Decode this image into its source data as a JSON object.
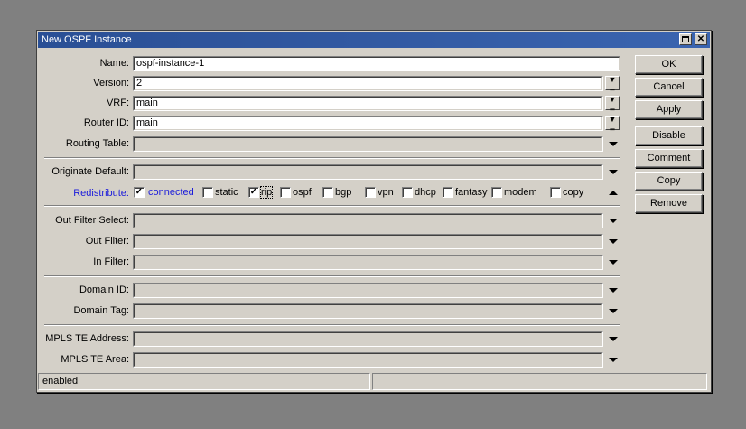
{
  "window": {
    "title": "New OSPF Instance"
  },
  "fields": {
    "name": {
      "label": "Name:",
      "value": "ospf-instance-1"
    },
    "version": {
      "label": "Version:",
      "value": "2"
    },
    "vrf": {
      "label": "VRF:",
      "value": "main"
    },
    "router_id": {
      "label": "Router ID:",
      "value": "main"
    },
    "routing_table": {
      "label": "Routing Table:",
      "value": ""
    },
    "originate_default": {
      "label": "Originate Default:",
      "value": ""
    },
    "out_filter_select": {
      "label": "Out Filter Select:",
      "value": ""
    },
    "out_filter": {
      "label": "Out Filter:",
      "value": ""
    },
    "in_filter": {
      "label": "In Filter:",
      "value": ""
    },
    "domain_id": {
      "label": "Domain ID:",
      "value": ""
    },
    "domain_tag": {
      "label": "Domain Tag:",
      "value": ""
    },
    "mpls_te_address": {
      "label": "MPLS TE Address:",
      "value": ""
    },
    "mpls_te_area": {
      "label": "MPLS TE Area:",
      "value": ""
    }
  },
  "redistribute": {
    "label": "Redistribute:",
    "label_color": "#1a1adb",
    "options": [
      {
        "label": "connected",
        "checked": true
      },
      {
        "label": "static",
        "checked": false
      },
      {
        "label": "rip",
        "checked": true
      },
      {
        "label": "ospf",
        "checked": false
      },
      {
        "label": "bgp",
        "checked": false
      },
      {
        "label": "vpn",
        "checked": false
      },
      {
        "label": "dhcp",
        "checked": false
      },
      {
        "label": "fantasy",
        "checked": false
      },
      {
        "label": "modem",
        "checked": false
      },
      {
        "label": "copy",
        "checked": false
      }
    ]
  },
  "buttons": {
    "ok": "OK",
    "cancel": "Cancel",
    "apply": "Apply",
    "disable": "Disable",
    "comment": "Comment",
    "copy": "Copy",
    "remove": "Remove"
  },
  "status": {
    "left": "enabled",
    "right": ""
  },
  "colors": {
    "titlebar": "#2a4f95",
    "window_bg": "#d4d0c8",
    "desktop": "#808080"
  }
}
